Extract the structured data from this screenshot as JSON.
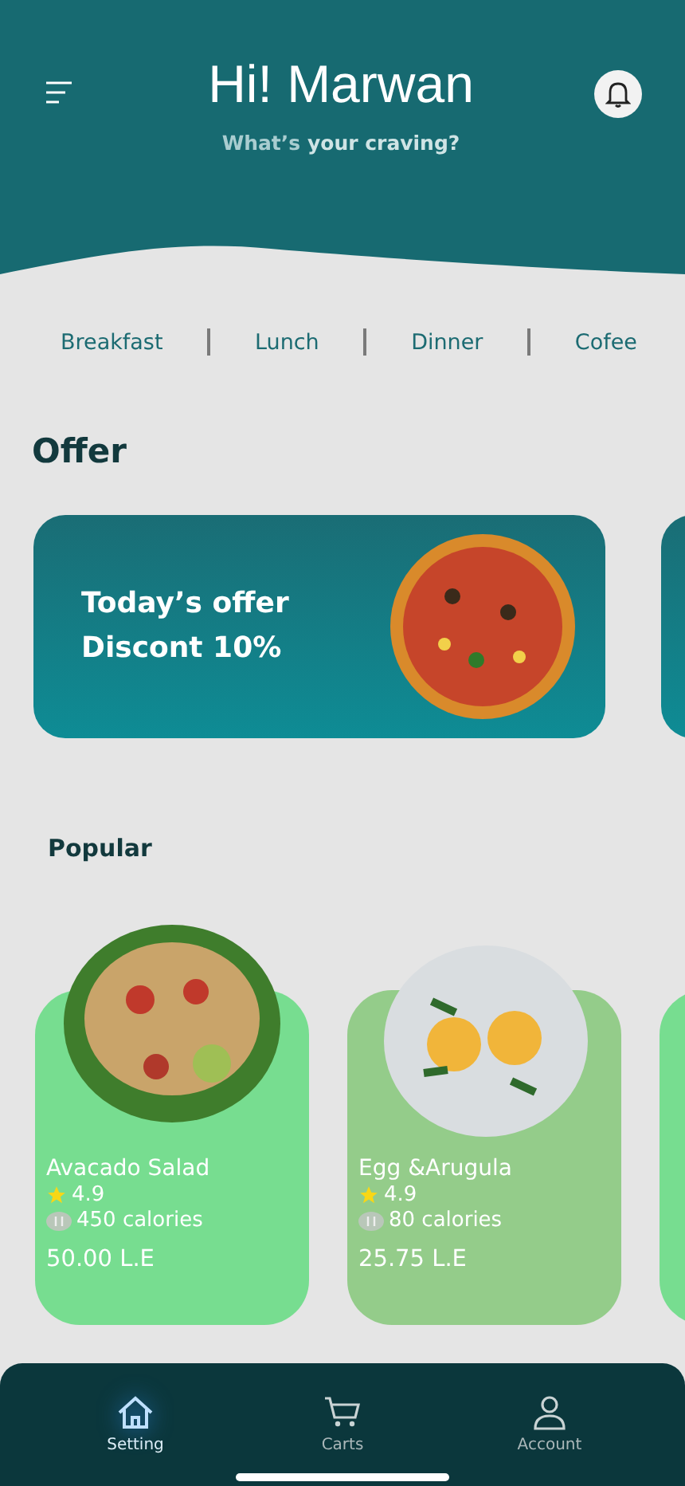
{
  "header": {
    "title": "Hi! Marwan",
    "subtitle_prefix": "What’s",
    "subtitle_emphasis": "your craving?"
  },
  "categories": [
    {
      "label": "Breakfast"
    },
    {
      "label": "Lunch"
    },
    {
      "label": "Dinner"
    },
    {
      "label": "Cofee"
    }
  ],
  "offer": {
    "heading": "Offer",
    "cards": [
      {
        "kind": "full",
        "line_1": "Today’s offer",
        "line_2": "Discont 10%"
      },
      {
        "kind": "peek"
      }
    ]
  },
  "popular": {
    "heading": "Popular",
    "items": [
      {
        "kind": "salad",
        "name": "Avacado Salad",
        "rating": "4.9",
        "calories": "450 calories",
        "price": "50.00 L.E",
        "color": "#77dd90"
      },
      {
        "kind": "plate",
        "name": "Egg &Arugula",
        "rating": "4.9",
        "calories": "80 calories",
        "price": "25.75 L.E",
        "color": "#94cc8a"
      },
      {
        "kind": "peek",
        "color": "#77dd90"
      }
    ]
  },
  "nav": [
    {
      "label": "Setting",
      "selected": true
    },
    {
      "label": "Carts",
      "selected": false
    },
    {
      "label": "Account",
      "selected": false
    }
  ]
}
